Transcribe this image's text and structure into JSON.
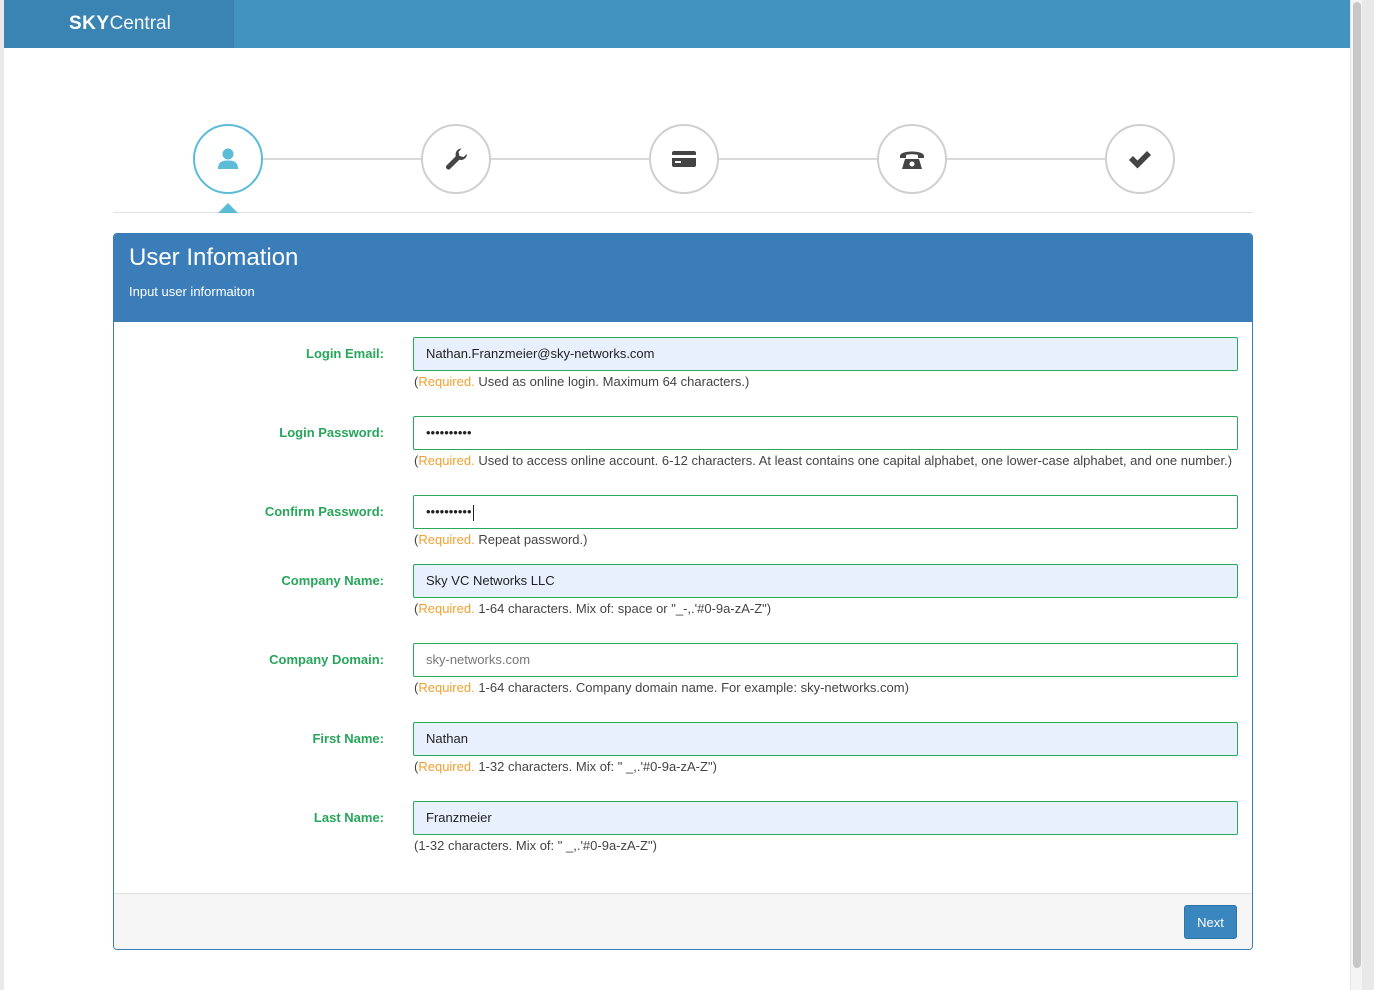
{
  "brand": {
    "bold": "SKY",
    "light": "Central"
  },
  "steps": [
    {
      "name": "user",
      "icon": "user-icon",
      "active": true
    },
    {
      "name": "settings",
      "icon": "wrench-icon",
      "active": false
    },
    {
      "name": "payment",
      "icon": "credit-card-icon",
      "active": false
    },
    {
      "name": "phone",
      "icon": "phone-icon",
      "active": false
    },
    {
      "name": "confirm",
      "icon": "checkmark-icon",
      "active": false
    }
  ],
  "panel": {
    "title": "User Infomation",
    "subtitle": "Input user informaiton"
  },
  "form": {
    "login_email": {
      "label": "Login Email:",
      "value": "Nathan.Franzmeier@sky-networks.com",
      "required": "Required.",
      "help": " Used as online login. Maximum 64 characters.)"
    },
    "login_password": {
      "label": "Login Password:",
      "value": "••••••••••",
      "required": "Required.",
      "help": " Used to access online account. 6-12 characters. At least contains one capital alphabet, one lower-case alphabet, and one number.)"
    },
    "confirm_password": {
      "label": "Confirm Password:",
      "value": "••••••••••",
      "required": "Required.",
      "help": " Repeat password.)"
    },
    "company_name": {
      "label": "Company Name:",
      "value": "Sky VC Networks LLC",
      "required": "Required.",
      "help": " 1-64 characters. Mix of: space or \"_-,.'#0-9a-zA-Z\")"
    },
    "company_domain": {
      "label": "Company Domain:",
      "placeholder": "sky-networks.com",
      "required": "Required.",
      "help": " 1-64 characters. Company domain name. For example: sky-networks.com)"
    },
    "first_name": {
      "label": "First Name:",
      "value": "Nathan",
      "required": "Required.",
      "help": " 1-32 characters. Mix of: \" _,.'#0-9a-zA-Z\")"
    },
    "last_name": {
      "label": "Last Name:",
      "value": "Franzmeier",
      "help": "(1-32 characters. Mix of: \" _,.'#0-9a-zA-Z\")"
    }
  },
  "footer": {
    "next_label": "Next"
  },
  "colors": {
    "header": "#4393c1",
    "panel_header": "#3a7db9",
    "label_green": "#27a55a",
    "required_orange": "#f0a030",
    "active_step": "#5bbcd8"
  }
}
